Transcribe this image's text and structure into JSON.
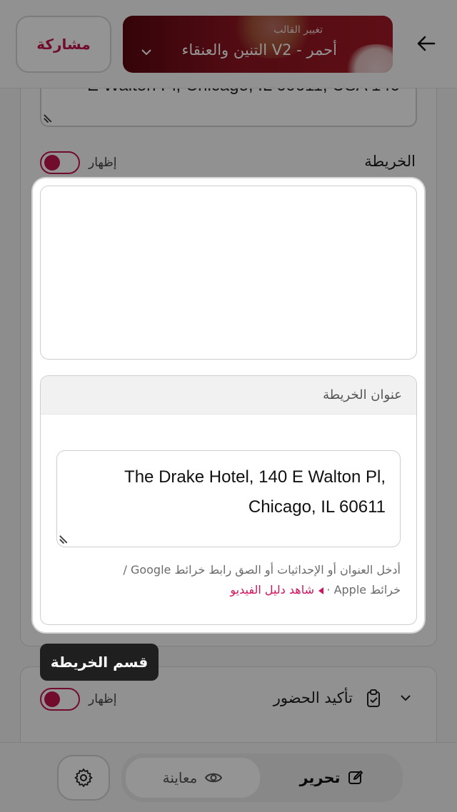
{
  "header": {
    "share_label": "مشاركة",
    "template_small": "تغيير القالب",
    "template_name": "التنين والعنقاء V2 - أحمر"
  },
  "background": {
    "address_fragment": "E Walton Pl, Chicago, IL 60611, USA 140",
    "map_section_label": "الخريطة",
    "show_label": "إظهار",
    "rsvp_label": "تأكيد الحضور",
    "rsvp_show_label": "إظهار"
  },
  "map_card": {
    "address_heading": "عنوان الخريطة",
    "address_value": "The Drake Hotel, 140 E Walton Pl, Chicago, IL 60611",
    "help_line1": "أدخل العنوان أو الإحداثيات أو الصق رابط خرائط Google /",
    "help_line2": "خرائط Apple ·",
    "video_link": "شاهد دليل الفيديو"
  },
  "tooltip": {
    "text": "قسم الخريطة"
  },
  "bottom_bar": {
    "preview_label": "معاينة",
    "edit_label": "تحرير"
  },
  "colors": {
    "accent": "#c5154f",
    "link": "#d0135e"
  }
}
